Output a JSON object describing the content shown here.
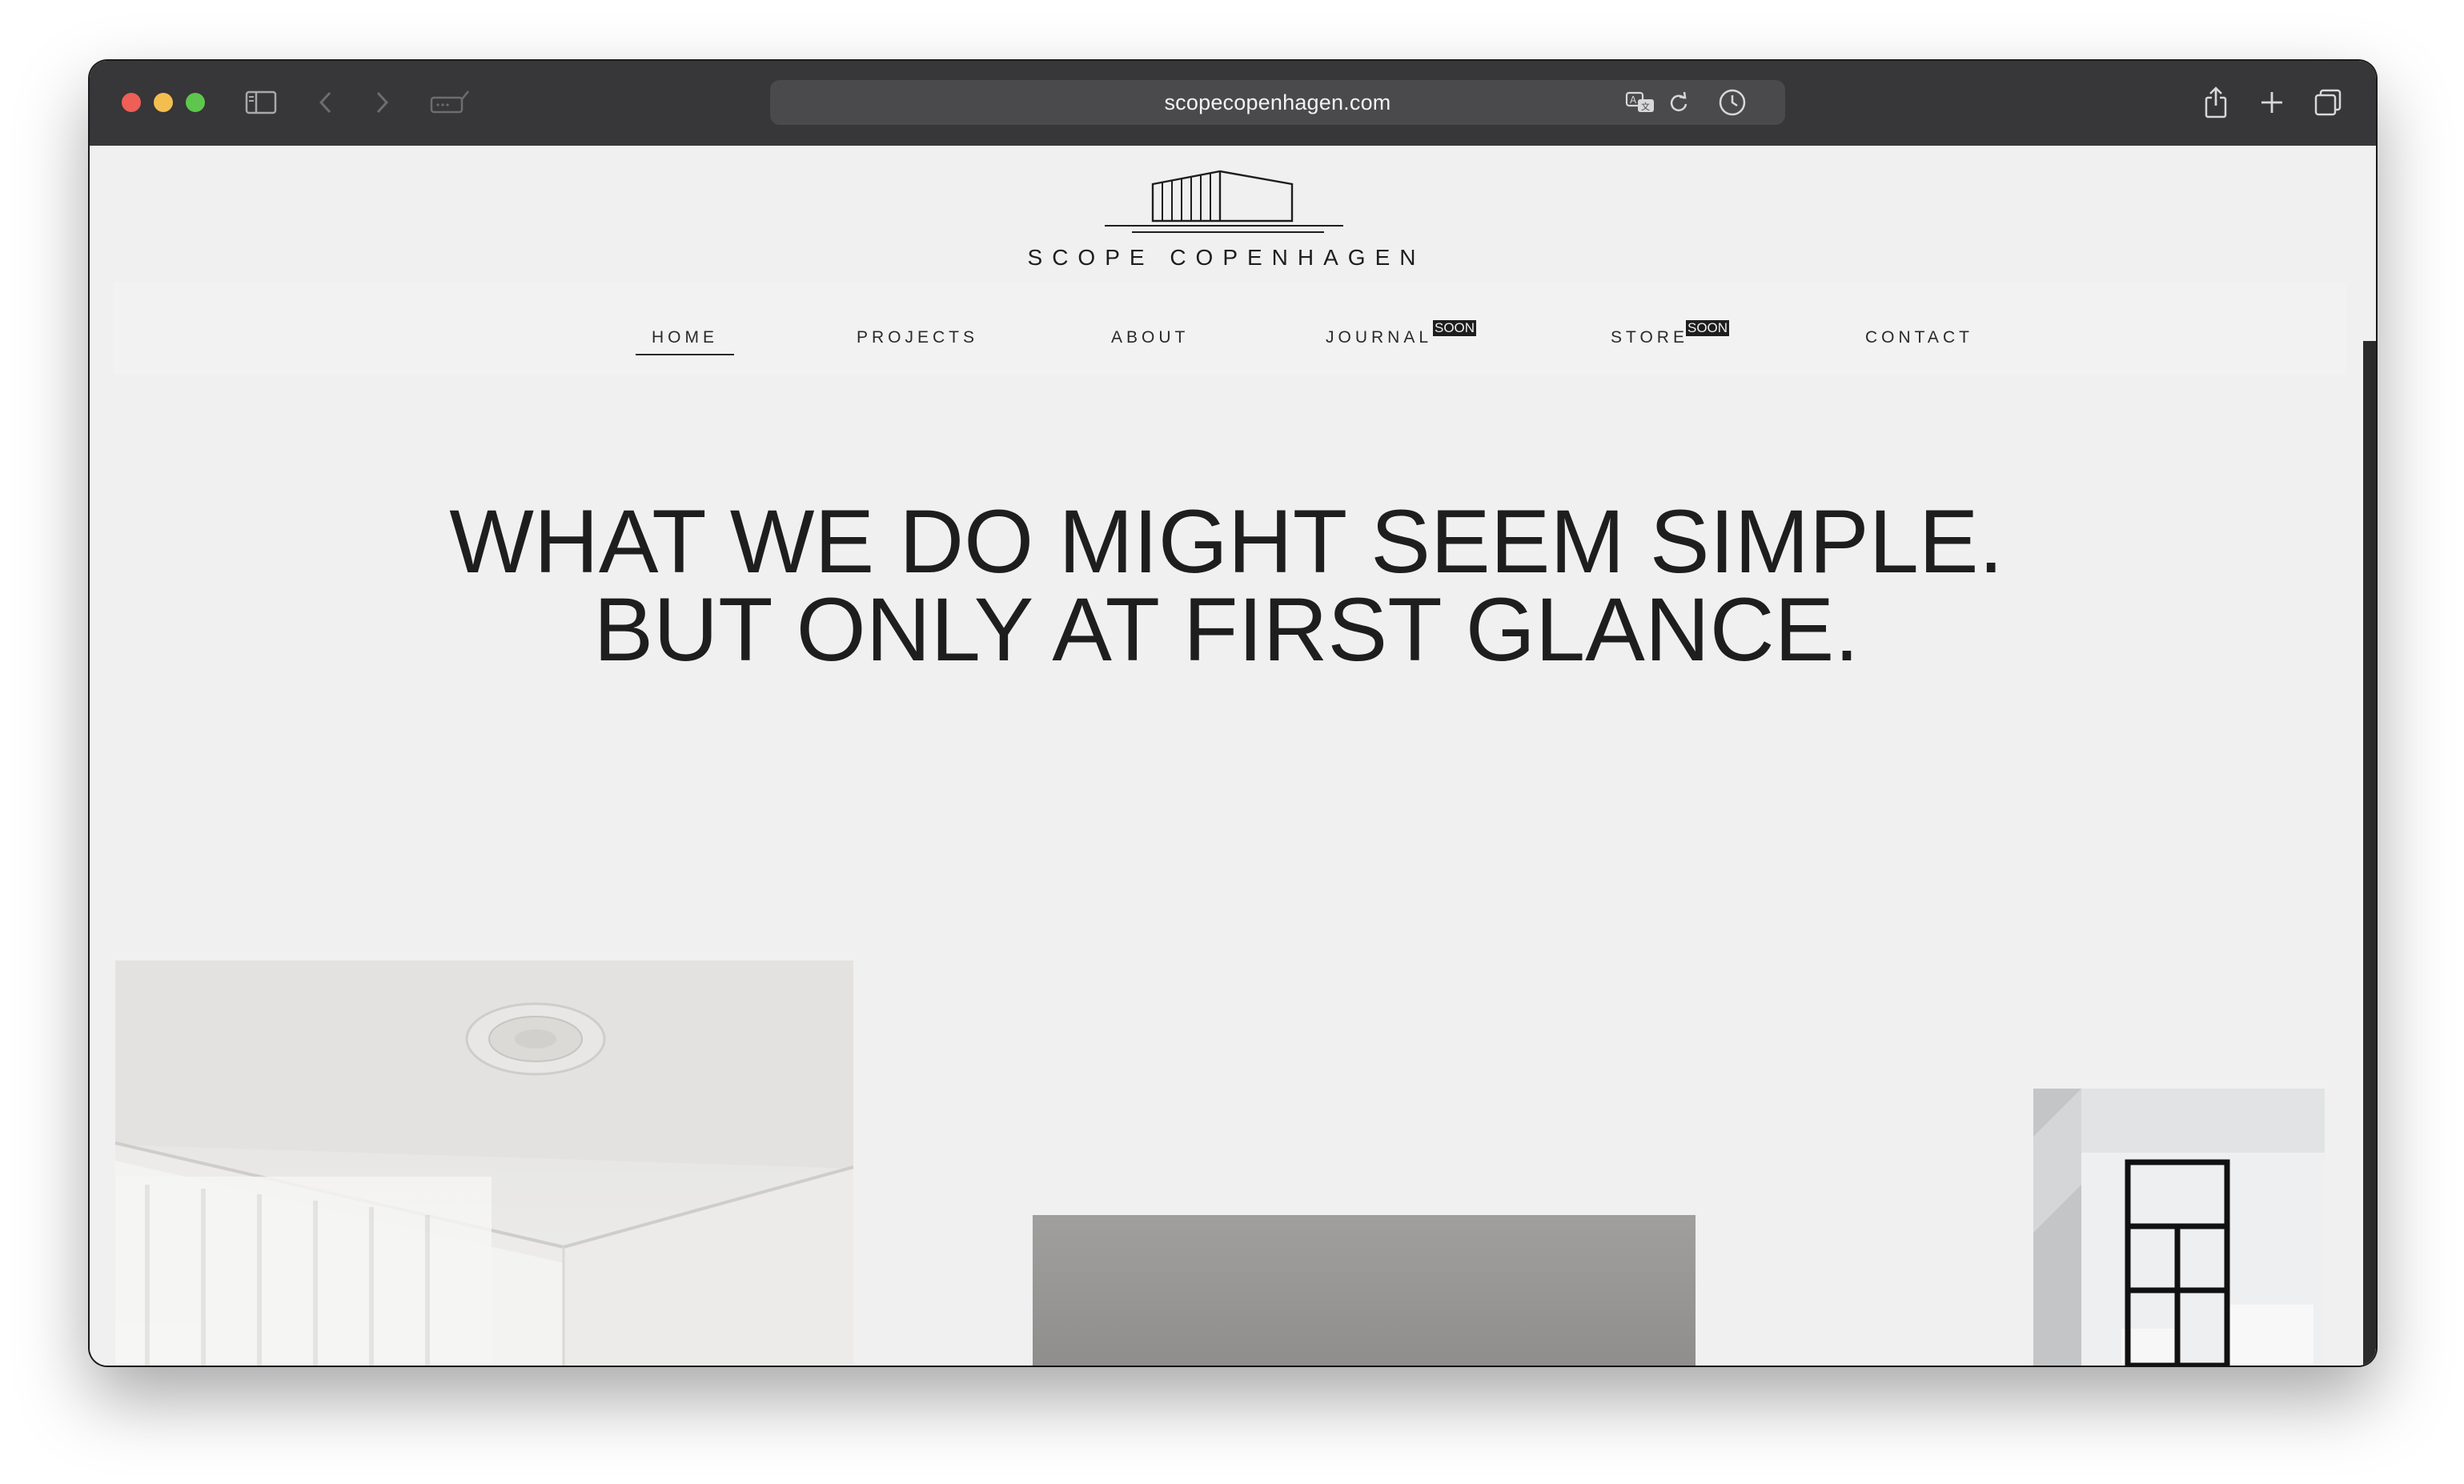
{
  "browser": {
    "url": "scopecopenhagen.com"
  },
  "site": {
    "brand": "SCOPE COPENHAGEN",
    "nav": [
      {
        "label": "HOME"
      },
      {
        "label": "PROJECTS"
      },
      {
        "label": "ABOUT"
      },
      {
        "label": "JOURNAL",
        "badge": "SOON"
      },
      {
        "label": "STORE",
        "badge": "SOON"
      },
      {
        "label": "CONTACT"
      }
    ],
    "hero": {
      "line1": "WHAT WE DO MIGHT SEEM SIMPLE.",
      "line2": "BUT ONLY AT FIRST GLANCE."
    },
    "gallery": [
      {
        "subject": "bright room with ceiling rosette and sheer curtains"
      },
      {
        "subject": "grey interior surface"
      },
      {
        "subject": "white room with black framed glass door"
      }
    ]
  },
  "colors": {
    "toolbar": "#373638",
    "page_background": "#f0f0f0",
    "text": "#1e1e1e"
  }
}
